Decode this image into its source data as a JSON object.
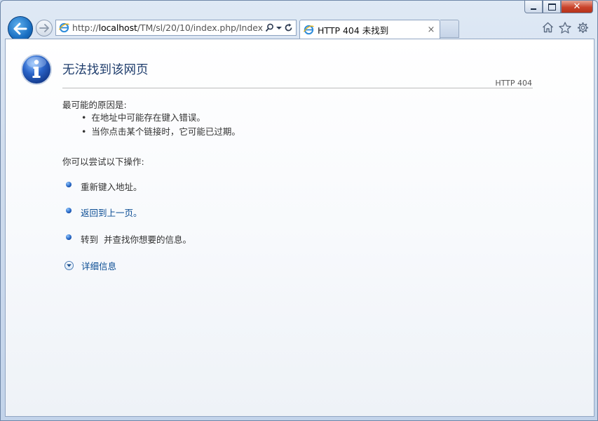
{
  "window": {
    "minimize": "minimize",
    "maximize": "maximize",
    "close": "close"
  },
  "nav": {
    "back_icon": "back-arrow-icon",
    "forward_icon": "forward-arrow-icon"
  },
  "address": {
    "url_prefix": "http://",
    "url_host": "localhost",
    "url_path": "/TM/sl/20/10/index.php/Index",
    "search_icon": "search-icon",
    "dropdown_icon": "chevron-down-icon",
    "refresh_icon": "refresh-icon"
  },
  "tab": {
    "title": "HTTP 404 未找到",
    "close": "×"
  },
  "toolbar": {
    "icons": [
      "home-icon",
      "star-icon",
      "gear-icon"
    ]
  },
  "error": {
    "title": "无法找到该网页",
    "code": "HTTP 404",
    "reasons_heading": "最可能的原因是:",
    "reasons": [
      "在地址中可能存在键入错误。",
      "当你点击某个链接时，它可能已过期。"
    ],
    "actions_heading": "你可以尝试以下操作:",
    "actions": [
      {
        "text": "重新键入地址。",
        "link": false
      },
      {
        "text": "返回到上一页。",
        "link": true
      },
      {
        "text": "转到  并查找你想要的信息。",
        "link": false
      }
    ],
    "details": "详细信息"
  },
  "colors": {
    "heading": "#1f3d6c",
    "link": "#0b4d94",
    "close_button": "#c9432a",
    "back_button": "#1a6fc2"
  }
}
